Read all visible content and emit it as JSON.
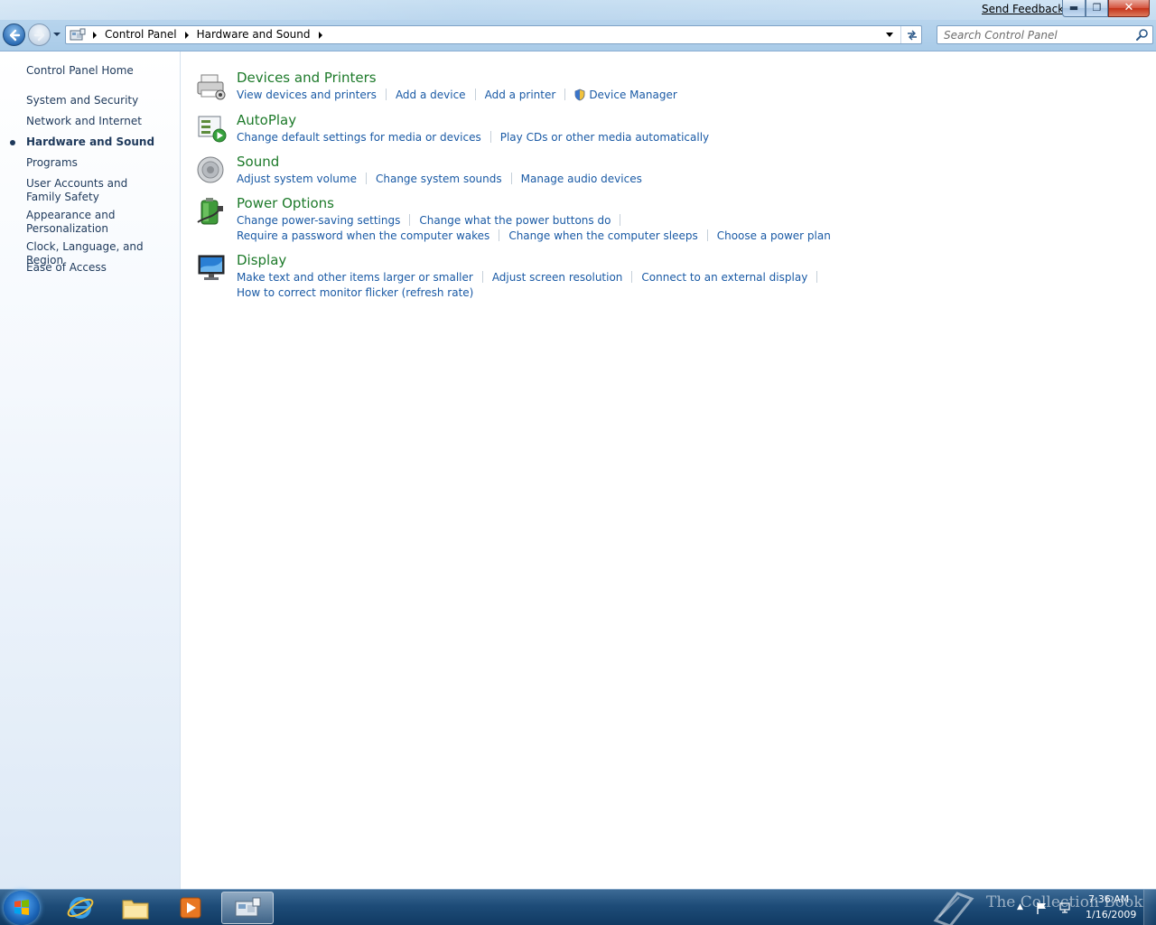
{
  "window": {
    "send_feedback": "Send Feedback",
    "minimize_glyph": "▬",
    "maximize_glyph": "❐",
    "close_glyph": "✕"
  },
  "address_bar": {
    "breadcrumbs": [
      "Control Panel",
      "Hardware and Sound"
    ],
    "search_placeholder": "Search Control Panel"
  },
  "sidebar": {
    "home": "Control Panel Home",
    "items": [
      {
        "label": "System and Security",
        "selected": false
      },
      {
        "label": "Network and Internet",
        "selected": false
      },
      {
        "label": "Hardware and Sound",
        "selected": true
      },
      {
        "label": "Programs",
        "selected": false
      },
      {
        "label": "User Accounts and Family Safety",
        "selected": false
      },
      {
        "label": "Appearance and Personalization",
        "selected": false
      },
      {
        "label": "Clock, Language, and Region",
        "selected": false
      },
      {
        "label": "Ease of Access",
        "selected": false
      }
    ]
  },
  "categories": [
    {
      "title": "Devices and Printers",
      "icon": "printer-icon",
      "links": [
        [
          "View devices and printers",
          "Add a device",
          "Add a printer",
          "Device Manager"
        ]
      ]
    },
    {
      "title": "AutoPlay",
      "icon": "autoplay-icon",
      "links": [
        [
          "Change default settings for media or devices",
          "Play CDs or other media automatically"
        ]
      ]
    },
    {
      "title": "Sound",
      "icon": "speaker-icon",
      "links": [
        [
          "Adjust system volume",
          "Change system sounds",
          "Manage audio devices"
        ]
      ]
    },
    {
      "title": "Power Options",
      "icon": "battery-icon",
      "links": [
        [
          "Change power-saving settings",
          "Change what the power buttons do"
        ],
        [
          "Require a password when the computer wakes",
          "Change when the computer sleeps",
          "Choose a power plan"
        ]
      ]
    },
    {
      "title": "Display",
      "icon": "monitor-icon",
      "links": [
        [
          "Make text and other items larger or smaller",
          "Adjust screen resolution",
          "Connect to an external display"
        ],
        [
          "How to correct monitor flicker (refresh rate)"
        ]
      ]
    }
  ],
  "taskbar": {
    "watermark": "The Collection Book",
    "clock_time": "7:36 AM",
    "clock_date": "1/16/2009"
  },
  "colors": {
    "category_title": "#1d7a2a",
    "task_link": "#1a5aa5",
    "nav_text": "#1e395b"
  }
}
